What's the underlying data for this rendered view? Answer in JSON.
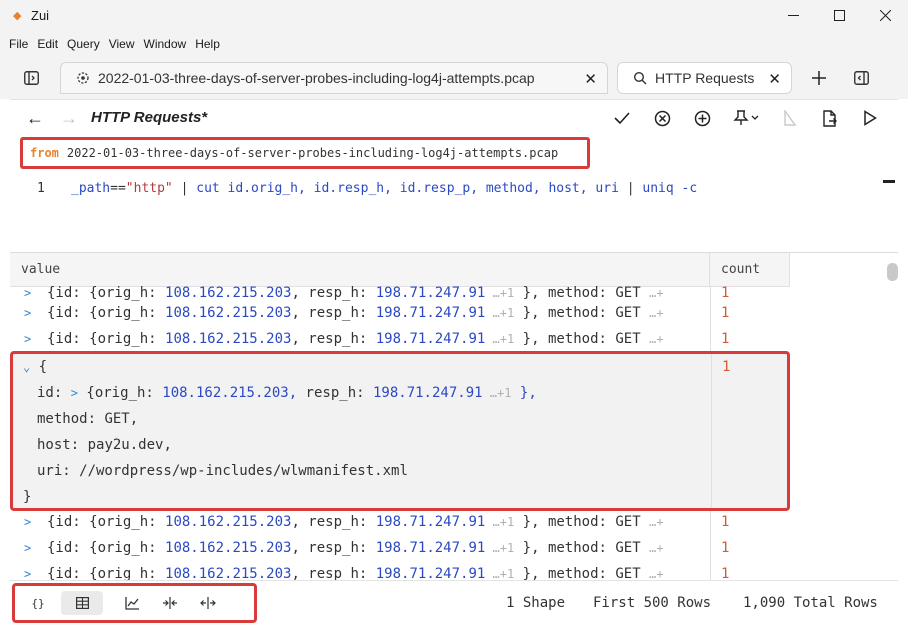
{
  "window": {
    "title": "Zui",
    "icons": [
      "minimize-icon",
      "maximize-icon",
      "close-icon"
    ]
  },
  "menu": [
    "File",
    "Edit",
    "Query",
    "View",
    "Window",
    "Help"
  ],
  "tabs": [
    {
      "label": "2022-01-03-three-days-of-server-probes-including-log4j-attempts.pcap",
      "icon": "pool-icon"
    },
    {
      "label": "HTTP Requests",
      "icon": "search-icon"
    }
  ],
  "query": {
    "title": "HTTP Requests*",
    "from_keyword": "from",
    "from_source": "2022-01-03-three-days-of-server-probes-including-log4j-attempts.pcap",
    "line_number": "1",
    "code": {
      "path_field": "_path",
      "eq": "==",
      "path_value": "\"http\"",
      "pipe1": " | ",
      "cut": "cut",
      "fields": " id.orig_h, id.resp_h, id.resp_p, method, host, uri",
      "pipe2": " | ",
      "uniq": "uniq",
      "flag": " -c"
    }
  },
  "results": {
    "columns": [
      "value",
      "count"
    ],
    "collapsed_row": {
      "prefix": "{id: {orig_h: ",
      "orig_h": "108.162.215.203",
      "resp_label": ", resp_h: ",
      "resp_h": "198.71.247.91",
      "more": " …+1",
      "suffix": " }, method: GET ",
      "tail": "…+",
      "count": "1"
    },
    "expanded": {
      "open": "{",
      "id_key": "id:",
      "id_prefix": " {orig_h: ",
      "orig_h": "108.162.215.203,",
      "resp_label": " resp_h: ",
      "resp_h": "198.71.247.91",
      "more": " …+1",
      "id_close": " },",
      "method_key": "method:",
      "method": " GET,",
      "host_key": "host:",
      "host": " pay2u.dev,",
      "uri_key": "uri:",
      "uri": " //wordpress/wp-includes/wlwmanifest.xml",
      "close": "}",
      "count": "1"
    }
  },
  "footer": {
    "views": [
      "{}",
      "table-icon",
      "chart-icon",
      "expand-icon",
      "collapse-icon"
    ],
    "shape": "1 Shape",
    "first": "First 500 Rows",
    "total": "1,090 Total Rows"
  },
  "colors": {
    "accent": "#2f87d6",
    "highlight": "#d93b3b",
    "keyword": "#e8822c",
    "field": "#2b49c3",
    "count": "#d45a3a"
  }
}
